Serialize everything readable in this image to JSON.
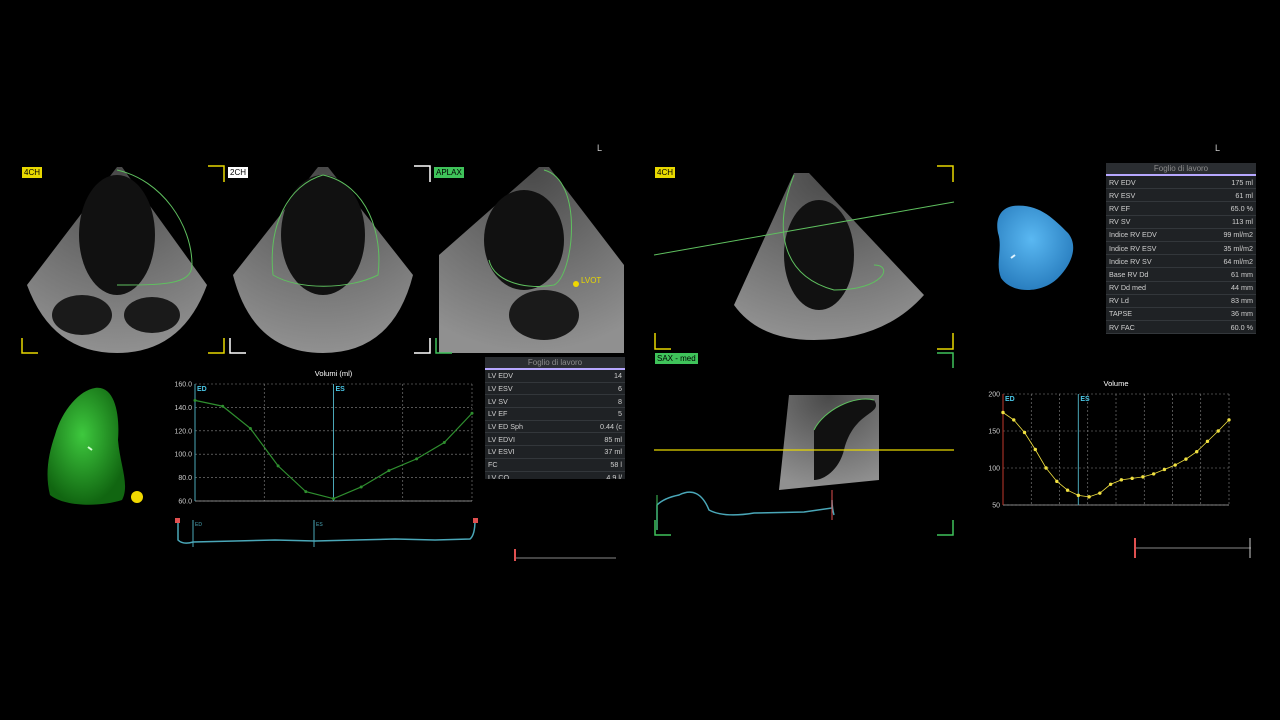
{
  "left_panel": {
    "orientation_mark": "L",
    "views": [
      {
        "label": "4CH",
        "style": "yellow"
      },
      {
        "label": "2CH",
        "style": "white"
      },
      {
        "label": "APLAX",
        "style": "green"
      }
    ],
    "lvot_label": "LVOT",
    "volume_chart_title": "Volumi (ml)",
    "ed_marker": "ED",
    "es_marker": "ES",
    "worksheet": {
      "title": "Foglio di lavoro",
      "rows": [
        {
          "label": "LV EDV",
          "value": "14"
        },
        {
          "label": "LV ESV",
          "value": "6"
        },
        {
          "label": "LV SV",
          "value": "8"
        },
        {
          "label": "LV EF",
          "value": "5"
        },
        {
          "label": "LV ED Sph",
          "value": "0.44 (c"
        },
        {
          "label": "LV EDVI",
          "value": "85 ml"
        },
        {
          "label": "LV ESVI",
          "value": "37 ml"
        },
        {
          "label": "FC",
          "value": "58 l"
        },
        {
          "label": "LV CO",
          "value": "4.9 l/"
        }
      ]
    },
    "model_color": "#1f9e1f"
  },
  "right_panel": {
    "orientation_mark": "L",
    "view_4ch": "4CH",
    "view_sax": "SAX - med",
    "volume_chart_title": "Volume",
    "ed_marker": "ED",
    "es_marker": "ES",
    "worksheet": {
      "title": "Foglio di lavoro",
      "rows": [
        {
          "label": "RV EDV",
          "value": "175 ml"
        },
        {
          "label": "RV ESV",
          "value": "61 ml"
        },
        {
          "label": "RV EF",
          "value": "65.0 %"
        },
        {
          "label": "RV SV",
          "value": "113 ml"
        },
        {
          "label": "Indice RV EDV",
          "value": "99 ml/m2"
        },
        {
          "label": "Indice RV ESV",
          "value": "35 ml/m2"
        },
        {
          "label": "Indice RV SV",
          "value": "64 ml/m2"
        },
        {
          "label": "Base RV Dd",
          "value": "61 mm"
        },
        {
          "label": "RV Dd med",
          "value": "44 mm"
        },
        {
          "label": "RV Ld",
          "value": "83 mm"
        },
        {
          "label": "TAPSE",
          "value": "36 mm"
        },
        {
          "label": "RV FAC",
          "value": "60.0 %"
        }
      ]
    },
    "model_color": "#3a9fe0"
  },
  "chart_data": [
    {
      "type": "line",
      "title": "Volumi (ml)",
      "ylim": [
        60,
        160
      ],
      "yticks": [
        "160.0",
        "140.0",
        "120.0",
        "100.0",
        "80.0",
        "60.0"
      ],
      "x": [
        0,
        1,
        2,
        3,
        4,
        5,
        6,
        7,
        8,
        9,
        10
      ],
      "series": [
        {
          "values": [
            146,
            141,
            122,
            90,
            68,
            62,
            72,
            86,
            96,
            110,
            135
          ]
        }
      ],
      "annotations": [
        "ED",
        "ES"
      ],
      "grid": true,
      "color": "#2f8f2f"
    },
    {
      "type": "line",
      "title": "Volume",
      "ylim": [
        50,
        200
      ],
      "yticks": [
        "200",
        "150",
        "100",
        "50"
      ],
      "x": [
        0,
        1,
        2,
        3,
        4,
        5,
        6,
        7,
        8,
        9,
        10,
        11,
        12,
        13,
        14,
        15,
        16,
        17,
        18,
        19,
        20,
        21
      ],
      "series": [
        {
          "values": [
            175,
            165,
            148,
            125,
            100,
            82,
            70,
            63,
            61,
            66,
            78,
            84,
            86,
            88,
            92,
            98,
            104,
            112,
            122,
            136,
            150,
            165
          ]
        }
      ],
      "annotations": [
        "ED",
        "ES"
      ],
      "grid": true,
      "color": "#f0e040"
    }
  ]
}
